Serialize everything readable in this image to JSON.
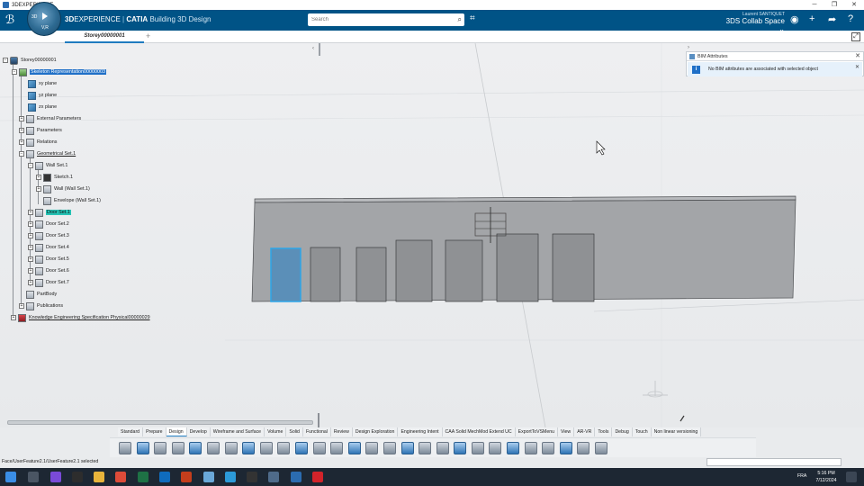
{
  "window": {
    "title": "3DEXPERIENCE"
  },
  "topbar": {
    "brand_prefix": "3D",
    "brand_name": "EXPERIENCE",
    "brand_sep": " | ",
    "brand_app": "CATIA",
    "brand_role": "Building 3D Design",
    "compass_label": "3D",
    "compass_version": "V,R",
    "search_placeholder": "Search",
    "user_name": "Laurent SANTIQUET",
    "collab_space": "3DS Collab Space",
    "colors": {
      "bar": "#005386",
      "accent": "#1f7bbf"
    }
  },
  "tabs": {
    "active": "Storey00000001"
  },
  "tree": {
    "nodes": [
      {
        "label": "Storey00000001"
      },
      {
        "label": "Skeleton Representation00000003"
      },
      {
        "label": "xy plane"
      },
      {
        "label": "yz plane"
      },
      {
        "label": "zx plane"
      },
      {
        "label": "External Parameters"
      },
      {
        "label": "Parameters"
      },
      {
        "label": "Relations"
      },
      {
        "label": "Geometrical Set.1"
      },
      {
        "label": "Wall Set.1"
      },
      {
        "label": "Sketch.1"
      },
      {
        "label": "Wall (Wall Set.1)"
      },
      {
        "label": "Envelope (Wall Set.1)"
      },
      {
        "label": "Door Set.1"
      },
      {
        "label": "Door Set.2"
      },
      {
        "label": "Door Set.3"
      },
      {
        "label": "Door Set.4"
      },
      {
        "label": "Door Set.5"
      },
      {
        "label": "Door Set.6"
      },
      {
        "label": "Door Set.7"
      },
      {
        "label": "PartBody"
      },
      {
        "label": "Publications"
      },
      {
        "label": "Knowledge Engineering Specification Physical00000029"
      }
    ]
  },
  "bim_panel": {
    "title": "BIM Attributes",
    "message": "No BIM attributes are associated with selected object"
  },
  "action_bar": {
    "tabs": [
      "Standard",
      "Prepare",
      "Design",
      "Develop",
      "Wireframe and Surface",
      "Volume",
      "Solid",
      "Functional",
      "Review",
      "Design Exploration",
      "Engineering Intent",
      "CAA Solid MechMod Extend UC",
      "ExportToVSMenu",
      "View",
      "AR-VR",
      "Tools",
      "Debug",
      "Touch",
      "Non linear versioning"
    ],
    "active_tab": "Design"
  },
  "status": {
    "text": "Face/UserFeature2.1/UserFeature2.1 selected"
  },
  "taskbar": {
    "lang": "FRA",
    "time": "5:16 PM",
    "date": "7/12/2024"
  }
}
